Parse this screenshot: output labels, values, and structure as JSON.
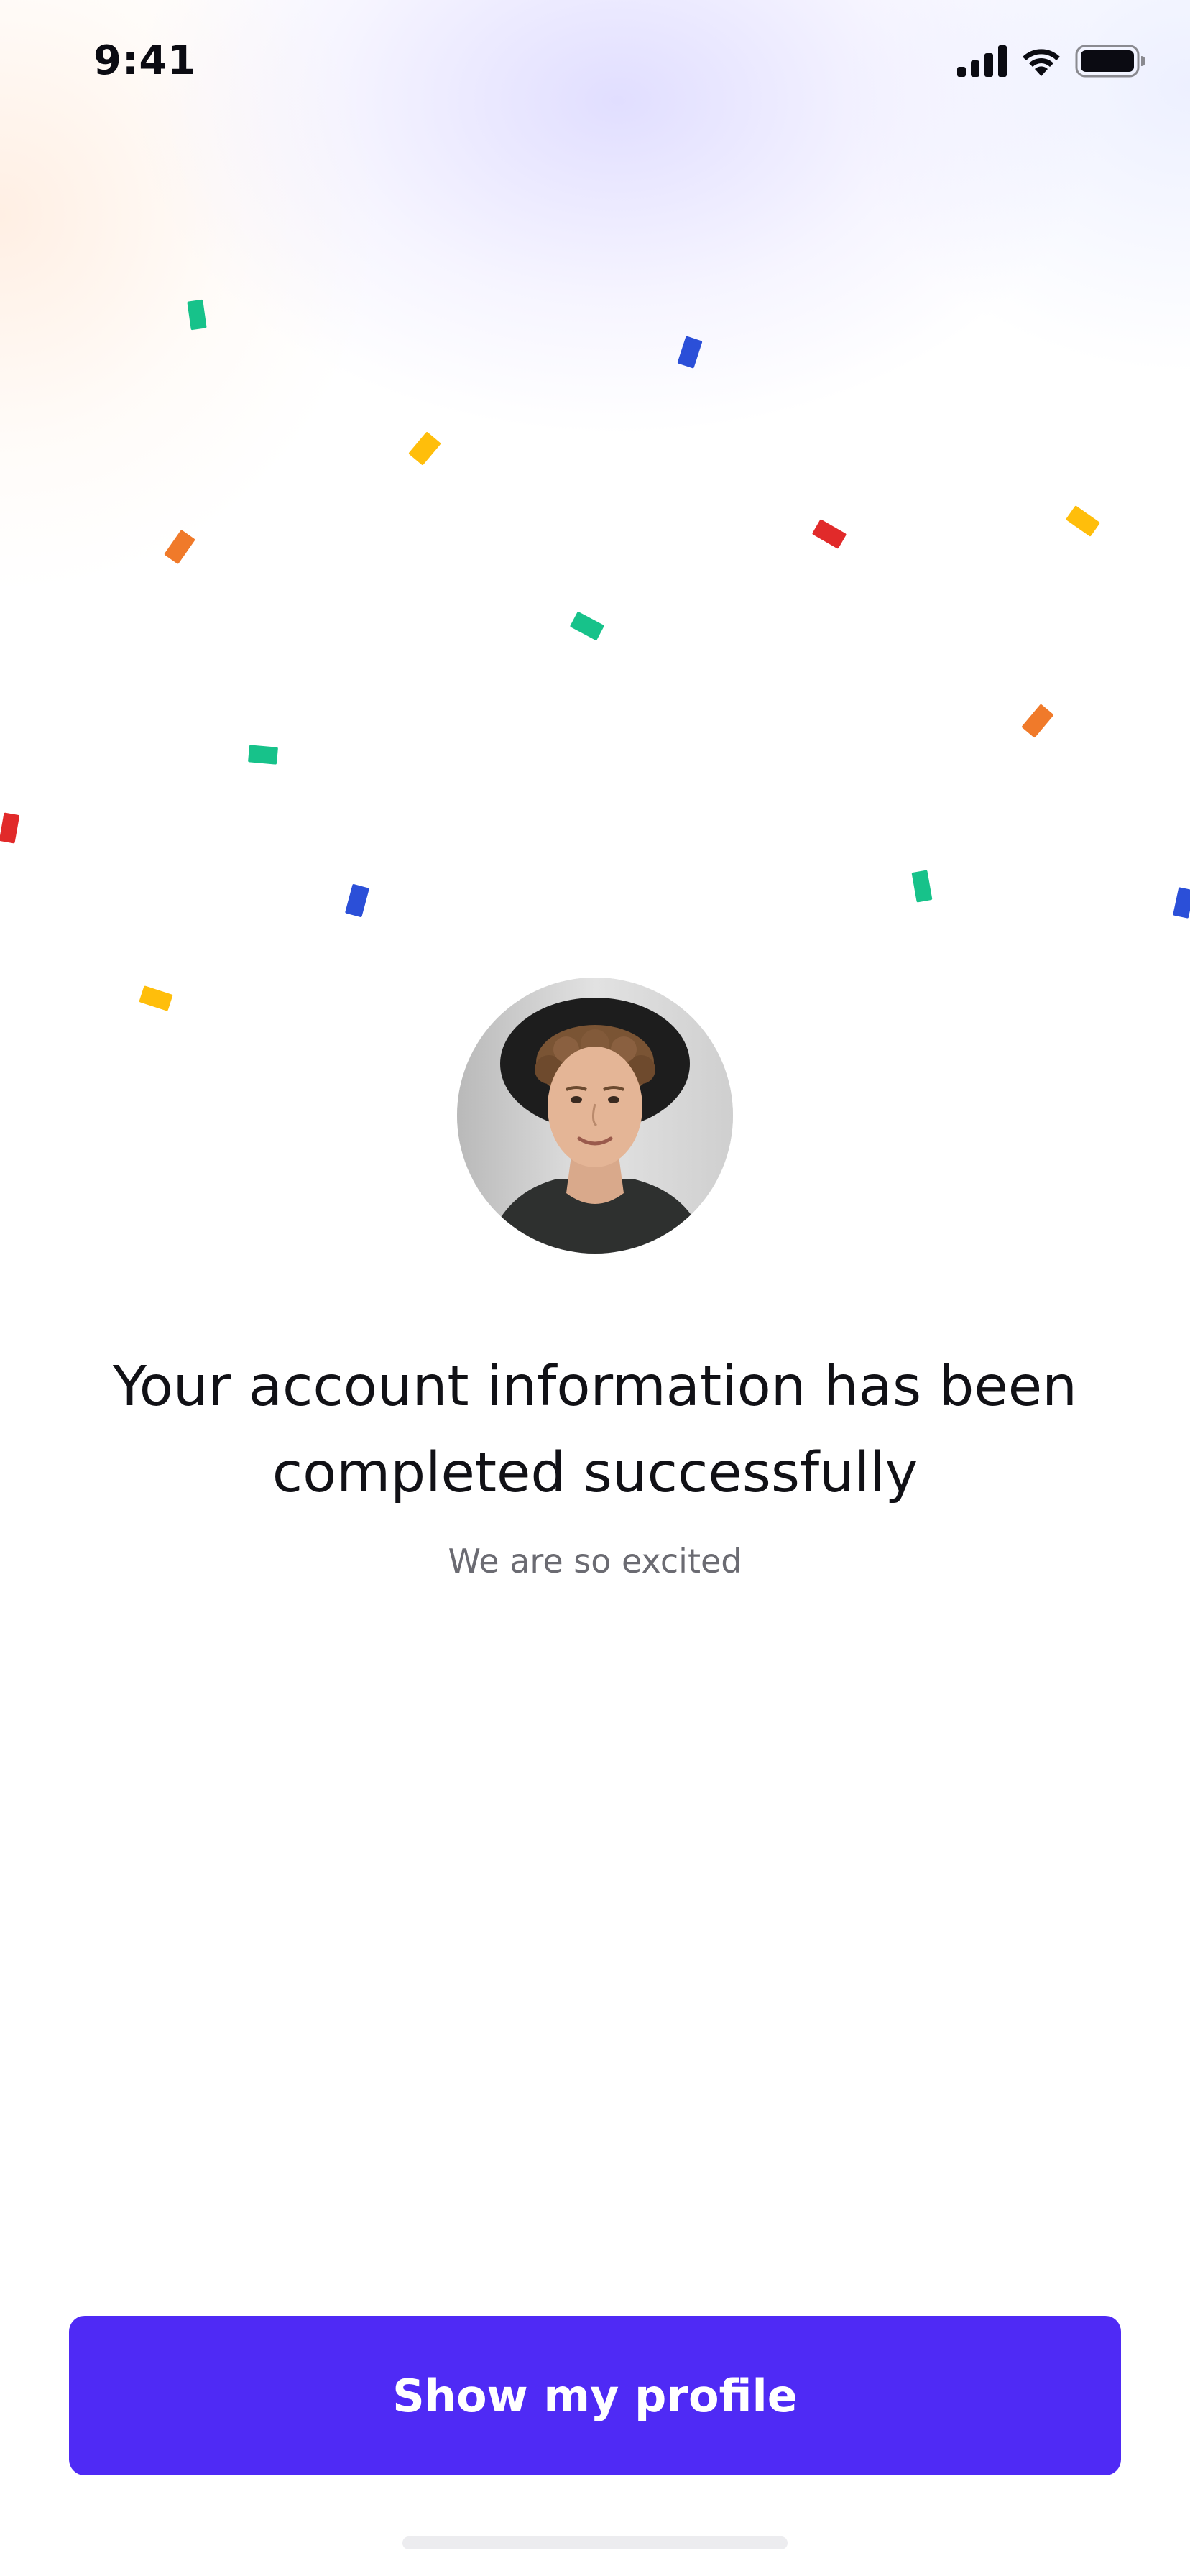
{
  "status_bar": {
    "time": "9:41",
    "icons": [
      "cellular-signal-icon",
      "wifi-icon",
      "battery-icon"
    ]
  },
  "decoration": {
    "confetti_colors": {
      "green": "#17c28a",
      "blue": "#2b4fd8",
      "yellow": "#ffbe0b",
      "orange": "#f07a2a",
      "red": "#e12a2a"
    }
  },
  "profile": {
    "avatar_description": "profile photo"
  },
  "content": {
    "headline": "Your account information has been completed successfully",
    "subtitle": "We are so excited"
  },
  "actions": {
    "primary_label": "Show my profile",
    "primary_color": "#4f2af5"
  }
}
